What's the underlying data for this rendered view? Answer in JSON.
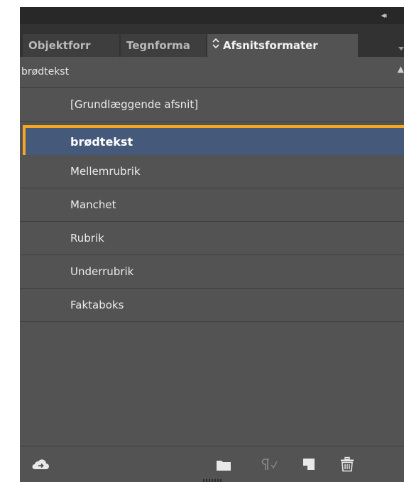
{
  "window": {
    "collapse_icon": "double-chevron-left-icon"
  },
  "tabs": [
    {
      "label": "Objektforr"
    },
    {
      "label": "Tegnforma"
    },
    {
      "label": "Afsnitsformater",
      "icon": "sort-arrows-icon",
      "active": true
    }
  ],
  "panel_menu_icon": "panel-menu-icon",
  "current_style": {
    "label": "brødtekst"
  },
  "styles": [
    {
      "label": "[Grundlæggende afsnit]"
    },
    {
      "label": "brødtekst",
      "selected": true
    },
    {
      "label": "Mellemrubrik"
    },
    {
      "label": "Manchet"
    },
    {
      "label": "Rubrik"
    },
    {
      "label": "Underrubrik"
    },
    {
      "label": "Faktaboks"
    }
  ],
  "bottom_toolbar": {
    "icons": [
      "cloud-library-icon",
      "new-folder-icon",
      "clear-overrides-icon",
      "new-style-icon",
      "trash-icon"
    ]
  },
  "colors": {
    "panel_bg": "#535353",
    "selected_bg": "#45597a",
    "highlight": "#f5a623"
  }
}
